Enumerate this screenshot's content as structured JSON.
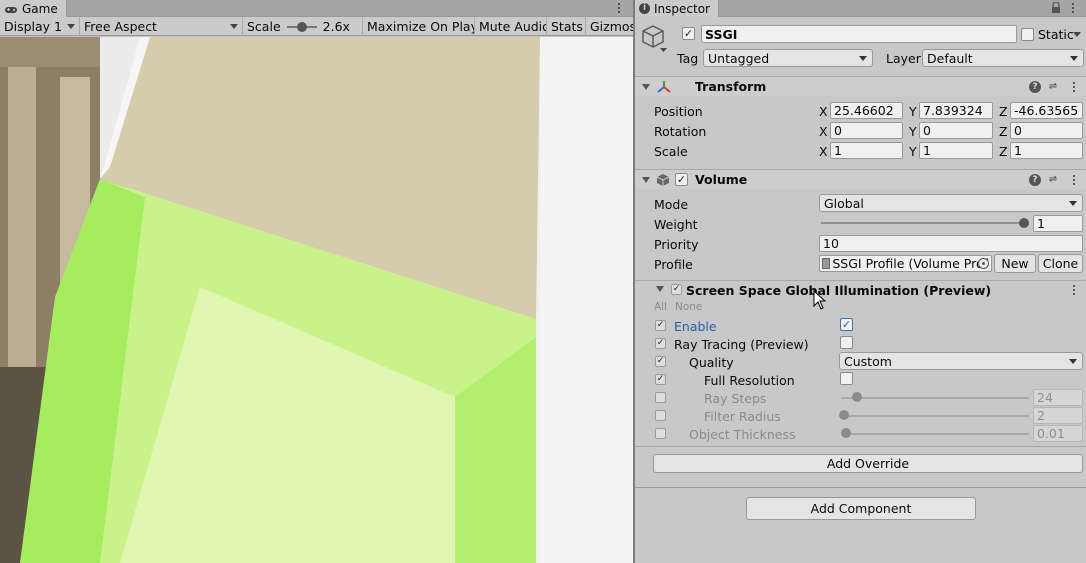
{
  "game": {
    "tab_label": "Game",
    "toolbar": {
      "display": "Display 1",
      "aspect": "Free Aspect",
      "scale_label": "Scale",
      "scale_value": "2.6x",
      "maximize": "Maximize On Play",
      "mute": "Mute Audio",
      "stats": "Stats",
      "gizmos": "Gizmos"
    }
  },
  "inspector": {
    "tab_label": "Inspector",
    "object_name": "SSGI",
    "static_label": "Static",
    "tag_label": "Tag",
    "tag_value": "Untagged",
    "layer_label": "Layer",
    "layer_value": "Default",
    "transform": {
      "title": "Transform",
      "position_label": "Position",
      "rotation_label": "Rotation",
      "scale_label": "Scale",
      "axis_x": "X",
      "axis_y": "Y",
      "axis_z": "Z",
      "position": [
        "25.46602",
        "7.839324",
        "-46.63565"
      ],
      "rotation": [
        "0",
        "0",
        "0"
      ],
      "scale": [
        "1",
        "1",
        "1"
      ]
    },
    "volume": {
      "title": "Volume",
      "mode_label": "Mode",
      "mode_value": "Global",
      "weight_label": "Weight",
      "weight_value": "1",
      "priority_label": "Priority",
      "priority_value": "10",
      "profile_label": "Profile",
      "profile_value": "SSGI Profile (Volume Prof",
      "new_button": "New",
      "clone_button": "Clone"
    },
    "ssgi": {
      "title": "Screen Space Global Illumination (Preview)",
      "all_label": "All",
      "none_label": "None",
      "enable_label": "Enable",
      "ray_tracing_label": "Ray Tracing (Preview)",
      "quality_label": "Quality",
      "quality_value": "Custom",
      "full_res_label": "Full Resolution",
      "ray_steps_label": "Ray Steps",
      "ray_steps_value": "24",
      "filter_radius_label": "Filter Radius",
      "filter_radius_value": "2",
      "object_thickness_label": "Object Thickness",
      "object_thickness_value": "0.01"
    },
    "add_override": "Add Override",
    "add_component": "Add Component"
  },
  "colors": {
    "green_face": "#c9f28a",
    "tan_face": "#d4ccaa",
    "link_blue": "#2a5da3"
  }
}
